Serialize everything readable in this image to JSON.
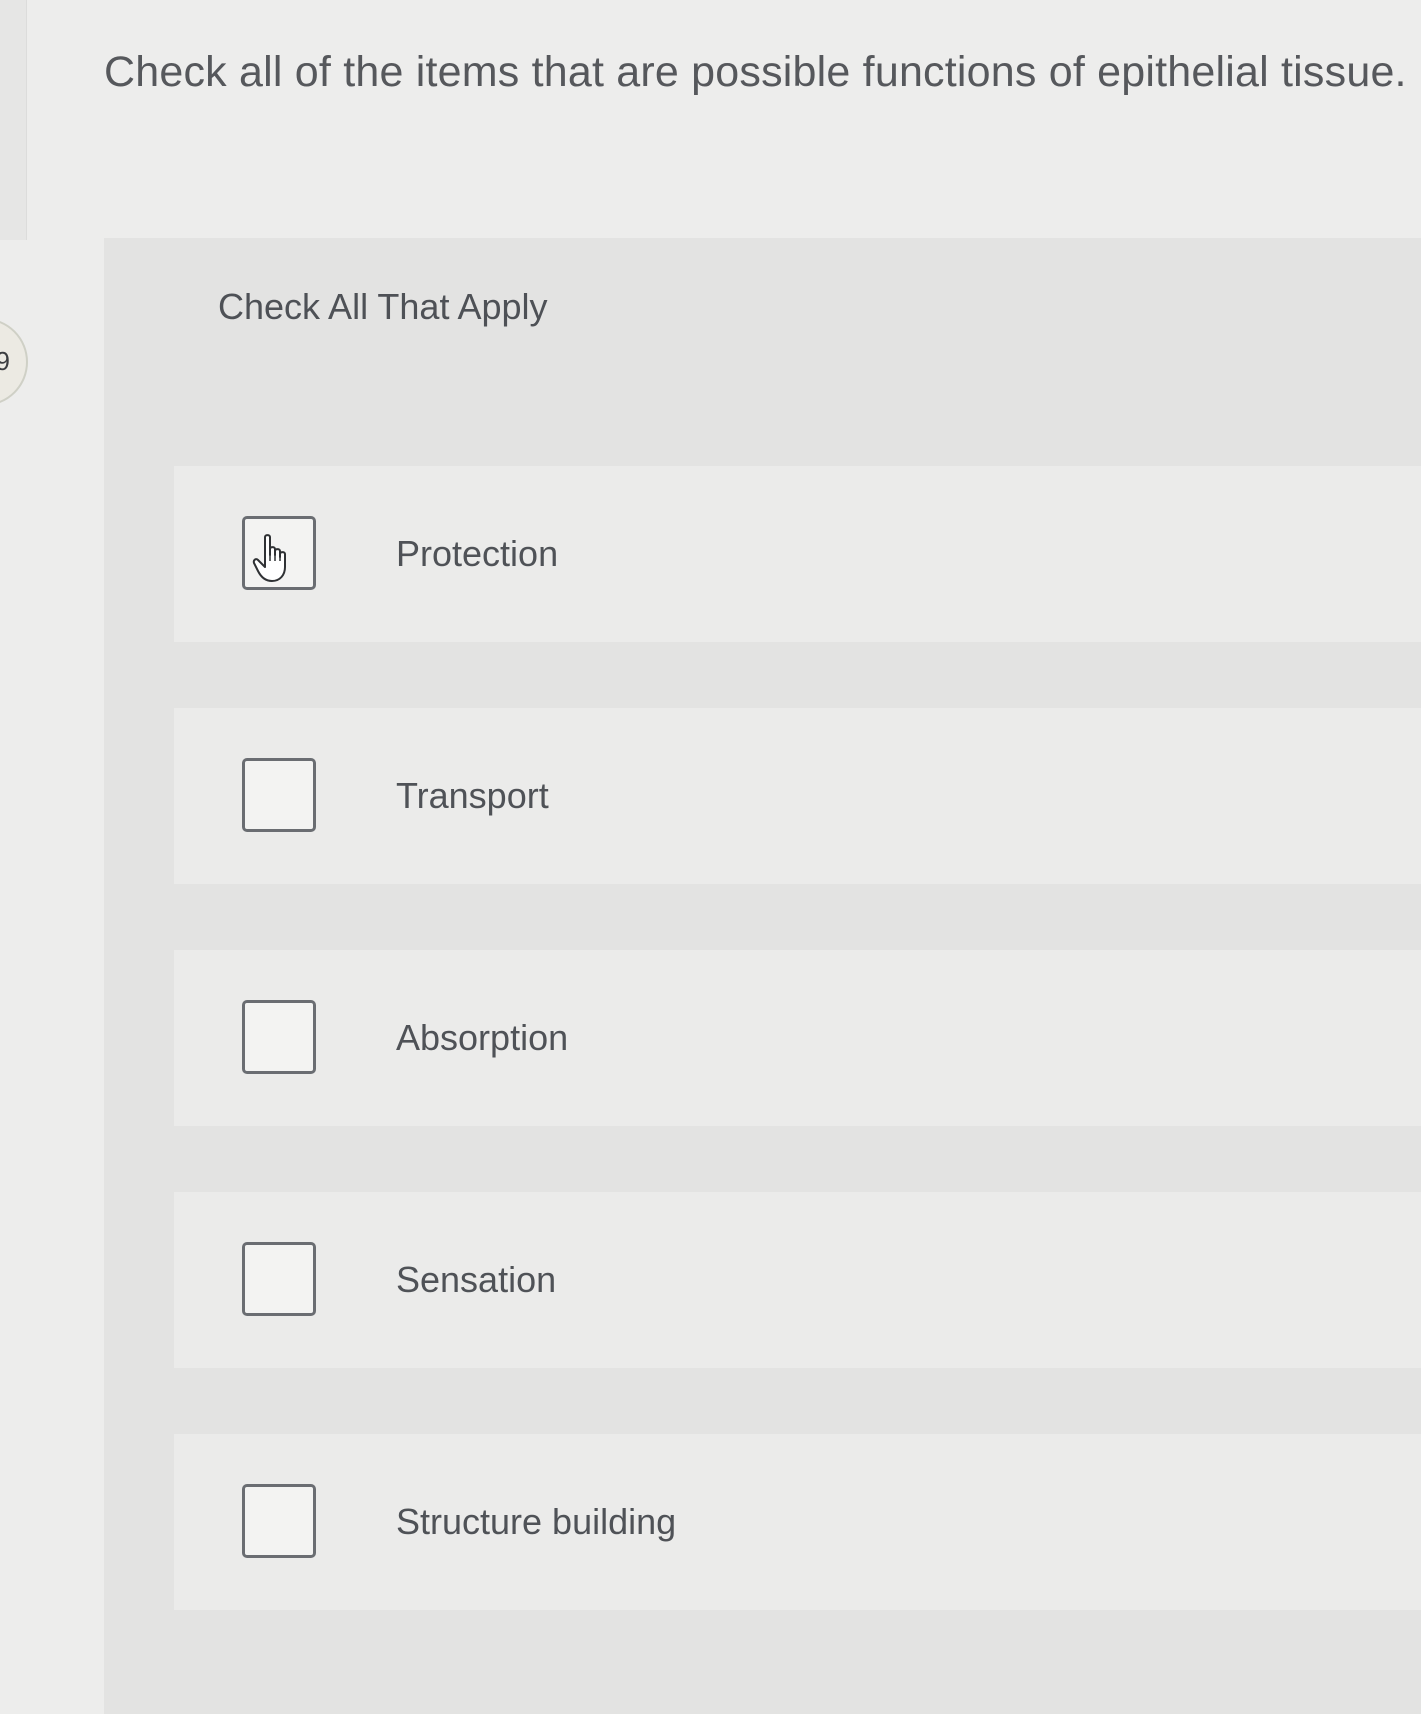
{
  "question": {
    "text": "Check all of the items that are possible functions of epithelial tissue."
  },
  "side_bubble": {
    "text": "9"
  },
  "panel": {
    "header_label": "Check All That Apply"
  },
  "options": [
    {
      "label": "Protection",
      "checked": false,
      "hovered": true
    },
    {
      "label": "Transport",
      "checked": false,
      "hovered": false
    },
    {
      "label": "Absorption",
      "checked": false,
      "hovered": false
    },
    {
      "label": "Sensation",
      "checked": false,
      "hovered": false
    },
    {
      "label": "Structure building",
      "checked": false,
      "hovered": false
    }
  ],
  "icons": {
    "cursor": "hand-pointer-cursor-icon"
  }
}
